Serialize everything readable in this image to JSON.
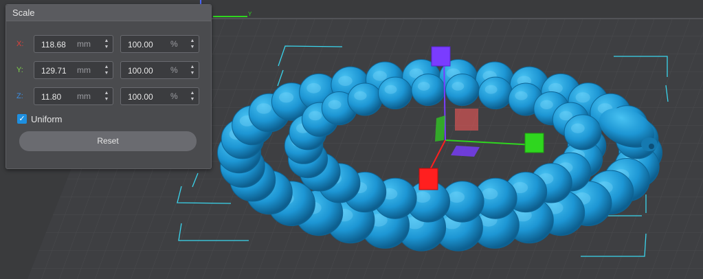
{
  "panel": {
    "title": "Scale",
    "rows": [
      {
        "axis": "X:",
        "axis_color": "#e0403a",
        "mm": "118.68",
        "mm_unit": "mm",
        "pct": "100.00",
        "pct_unit": "%"
      },
      {
        "axis": "Y:",
        "axis_color": "#7ed04a",
        "mm": "129.71",
        "mm_unit": "mm",
        "pct": "100.00",
        "pct_unit": "%"
      },
      {
        "axis": "Z:",
        "axis_color": "#3a8ee0",
        "mm": "11.80",
        "mm_unit": "mm",
        "pct": "100.00",
        "pct_unit": "%"
      }
    ],
    "uniform_label": "Uniform",
    "uniform_checked": true,
    "reset_label": "Reset"
  },
  "viewport": {
    "axis_indicator_label": "Y",
    "model_color": "#1e9ad6",
    "gizmo_colors": {
      "x": "#ff1f1f",
      "y": "#2fd61f",
      "z": "#7a3cff"
    }
  }
}
